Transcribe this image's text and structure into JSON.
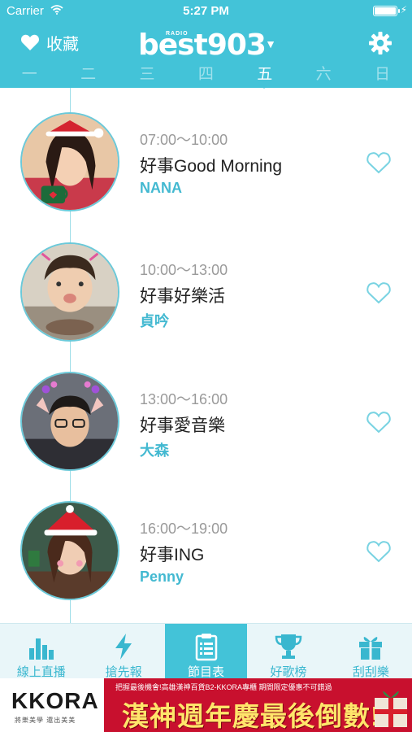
{
  "status_bar": {
    "carrier": "Carrier",
    "time": "5:27 PM"
  },
  "header": {
    "favorites_label": "收藏",
    "logo_radio": "RADIO",
    "logo_brand": "best903",
    "days": [
      {
        "label": "一",
        "active": false
      },
      {
        "label": "二",
        "active": false
      },
      {
        "label": "三",
        "active": false
      },
      {
        "label": "四",
        "active": false
      },
      {
        "label": "五",
        "active": true
      },
      {
        "label": "六",
        "active": false
      },
      {
        "label": "日",
        "active": false
      }
    ]
  },
  "schedule": [
    {
      "time": "07:00～10:00",
      "title": "好事Good Morning",
      "host": "NANA"
    },
    {
      "time": "10:00～13:00",
      "title": "好事好樂活",
      "host": "貞吟"
    },
    {
      "time": "13:00～16:00",
      "title": "好事愛音樂",
      "host": "大森"
    },
    {
      "time": "16:00～19:00",
      "title": "好事ING",
      "host": "Penny"
    }
  ],
  "tabs": [
    {
      "label": "線上直播",
      "icon": "bar-chart-icon",
      "active": false
    },
    {
      "label": "搶先報",
      "icon": "lightning-icon",
      "active": false
    },
    {
      "label": "節目表",
      "icon": "clipboard-icon",
      "active": true
    },
    {
      "label": "好歌榜",
      "icon": "trophy-icon",
      "active": false
    },
    {
      "label": "刮刮樂",
      "icon": "gift-icon",
      "active": false
    }
  ],
  "banner": {
    "brand": "KKORA",
    "brand_sub": "將樂美學 還出美美",
    "promo_top": "把握最後機會!高雄漢神百貨B2-KKORA專櫃 期間限定優惠不可錯過",
    "promo_main": "漢神週年慶最後倒數!"
  },
  "colors": {
    "accent": "#43c3d8",
    "host_text": "#43b9d1",
    "promo_red": "#c8102e"
  }
}
